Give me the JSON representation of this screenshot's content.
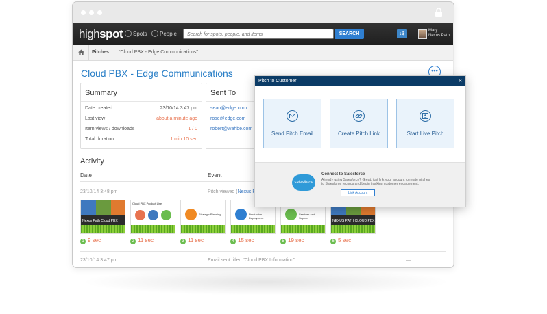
{
  "nav": {
    "logo_a": "high",
    "logo_b": "spot",
    "spots": "Spots",
    "people": "People",
    "search_placeholder": "Search for spots, people, and items",
    "search_button": "SEARCH",
    "badge": "↓$",
    "user_first": "Mary",
    "user_second": "Nexus Path"
  },
  "breadcrumb": {
    "pitches": "Pitches",
    "current": "\"Cloud PBX - Edge Communications\""
  },
  "page": {
    "title": "Cloud PBX - Edge Communications",
    "more": "•••"
  },
  "summary": {
    "title": "Summary",
    "rows": [
      {
        "label": "Date created",
        "value": "23/10/14 3:47 pm"
      },
      {
        "label": "Last view",
        "value": "about a minute ago"
      },
      {
        "label": "Item views / downloads",
        "value": "1 / 0"
      },
      {
        "label": "Total duration",
        "value": "1 min 10 sec"
      }
    ]
  },
  "sent_to": {
    "title": "Sent To",
    "emails": [
      "sean@edge.com",
      "rose@edge.com",
      "robert@wahbe.com"
    ]
  },
  "activity": {
    "title": "Activity",
    "col_date": "Date",
    "col_event": "Event",
    "row1_date": "23/10/14 3:48 pm",
    "row1_event_prefix": "Pitch viewed (",
    "row1_event_link": "Nexus P",
    "row2_date": "23/10/14 3:47 pm",
    "row2_event": "Email sent titled \"Cloud PBX Information\"",
    "row2_dash": "—",
    "thumbs": [
      {
        "num": "1",
        "time": "9 sec",
        "caption": "Nexus Path Cloud PBX"
      },
      {
        "num": "2",
        "time": "11 sec",
        "caption": "Cloud PBX Product Line"
      },
      {
        "num": "3",
        "time": "11 sec",
        "caption": "Strategic Planning"
      },
      {
        "num": "4",
        "time": "15 sec",
        "caption": "Production Deployment"
      },
      {
        "num": "5",
        "time": "19 sec",
        "caption": "Services And Support"
      },
      {
        "num": "6",
        "time": "5 sec",
        "caption": "NEXUS PATH CLOUD PBX"
      }
    ]
  },
  "modal": {
    "title": "Pitch to Customer",
    "close": "×",
    "options": [
      "Send Pitch Email",
      "Create Pitch Link",
      "Start Live Pitch"
    ],
    "sf_logo": "salesforce",
    "sf_title": "Connect to Salesforce",
    "sf_text": "Already using Salesforce? Great, just link your account to relate pitches to Salesforce records and begin tracking customer engagement.",
    "sf_button": "Link Account"
  },
  "colors": {
    "accent": "#2f7fd1",
    "title_blue": "#2a7fc7",
    "orange": "#e8734f",
    "green": "#6bbd4f",
    "modal_header": "#0b3b66"
  }
}
